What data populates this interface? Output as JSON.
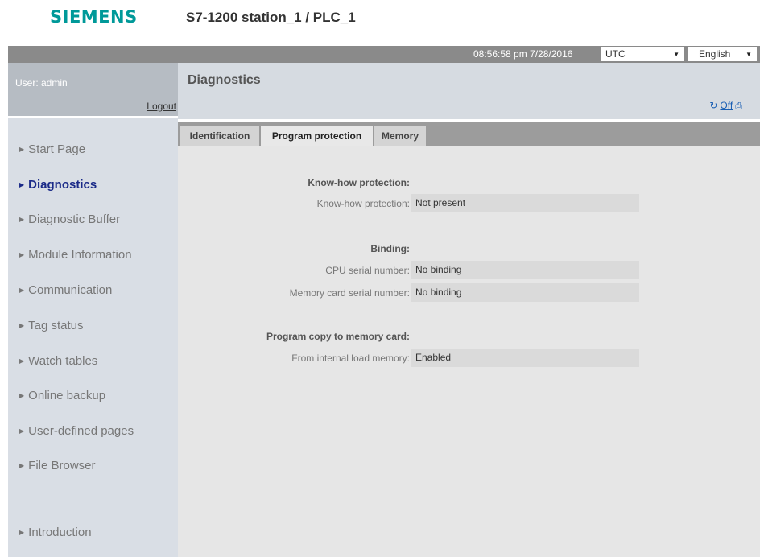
{
  "header": {
    "brand": "SIEMENS",
    "station": "S7-1200 station_1 / PLC_1"
  },
  "topbar": {
    "clock": "08:56:58 pm  7/28/2016",
    "timezone": "UTC",
    "language": "English"
  },
  "user": {
    "label": "User: admin",
    "logout": "Logout"
  },
  "nav": {
    "items": [
      {
        "label": "Start Page"
      },
      {
        "label": "Diagnostics"
      },
      {
        "label": "Diagnostic Buffer"
      },
      {
        "label": "Module Information"
      },
      {
        "label": "Communication"
      },
      {
        "label": "Tag status"
      },
      {
        "label": "Watch tables"
      },
      {
        "label": "Online backup"
      },
      {
        "label": "User-defined pages"
      },
      {
        "label": "File Browser"
      },
      {
        "label": "Introduction"
      }
    ],
    "active": "Diagnostics"
  },
  "main": {
    "title": "Diagnostics",
    "refresh_off": "Off",
    "tabs": [
      {
        "label": "Identification"
      },
      {
        "label": "Program protection"
      },
      {
        "label": "Memory"
      }
    ],
    "active_tab": "Program protection"
  },
  "protection": {
    "knowhow_title": "Know-how protection:",
    "knowhow_label": "Know-how protection:",
    "knowhow_value": "Not present",
    "binding_title": "Binding:",
    "cpu_serial_label": "CPU serial number:",
    "cpu_serial_value": "No binding",
    "memcard_serial_label": "Memory card serial number:",
    "memcard_serial_value": "No binding",
    "copy_title": "Program copy to memory card:",
    "internal_load_label": "From internal load memory:",
    "internal_load_value": "Enabled"
  },
  "icons": {
    "refresh": "refresh-icon",
    "print": "print-icon",
    "dropdown": "chevron-down-icon",
    "nav_bullet": "triangle-right-icon"
  },
  "colors": {
    "brand": "#009999",
    "active_nav": "#1a2a88",
    "topbar": "#8a8a8a",
    "link": "#1a5fb4"
  }
}
